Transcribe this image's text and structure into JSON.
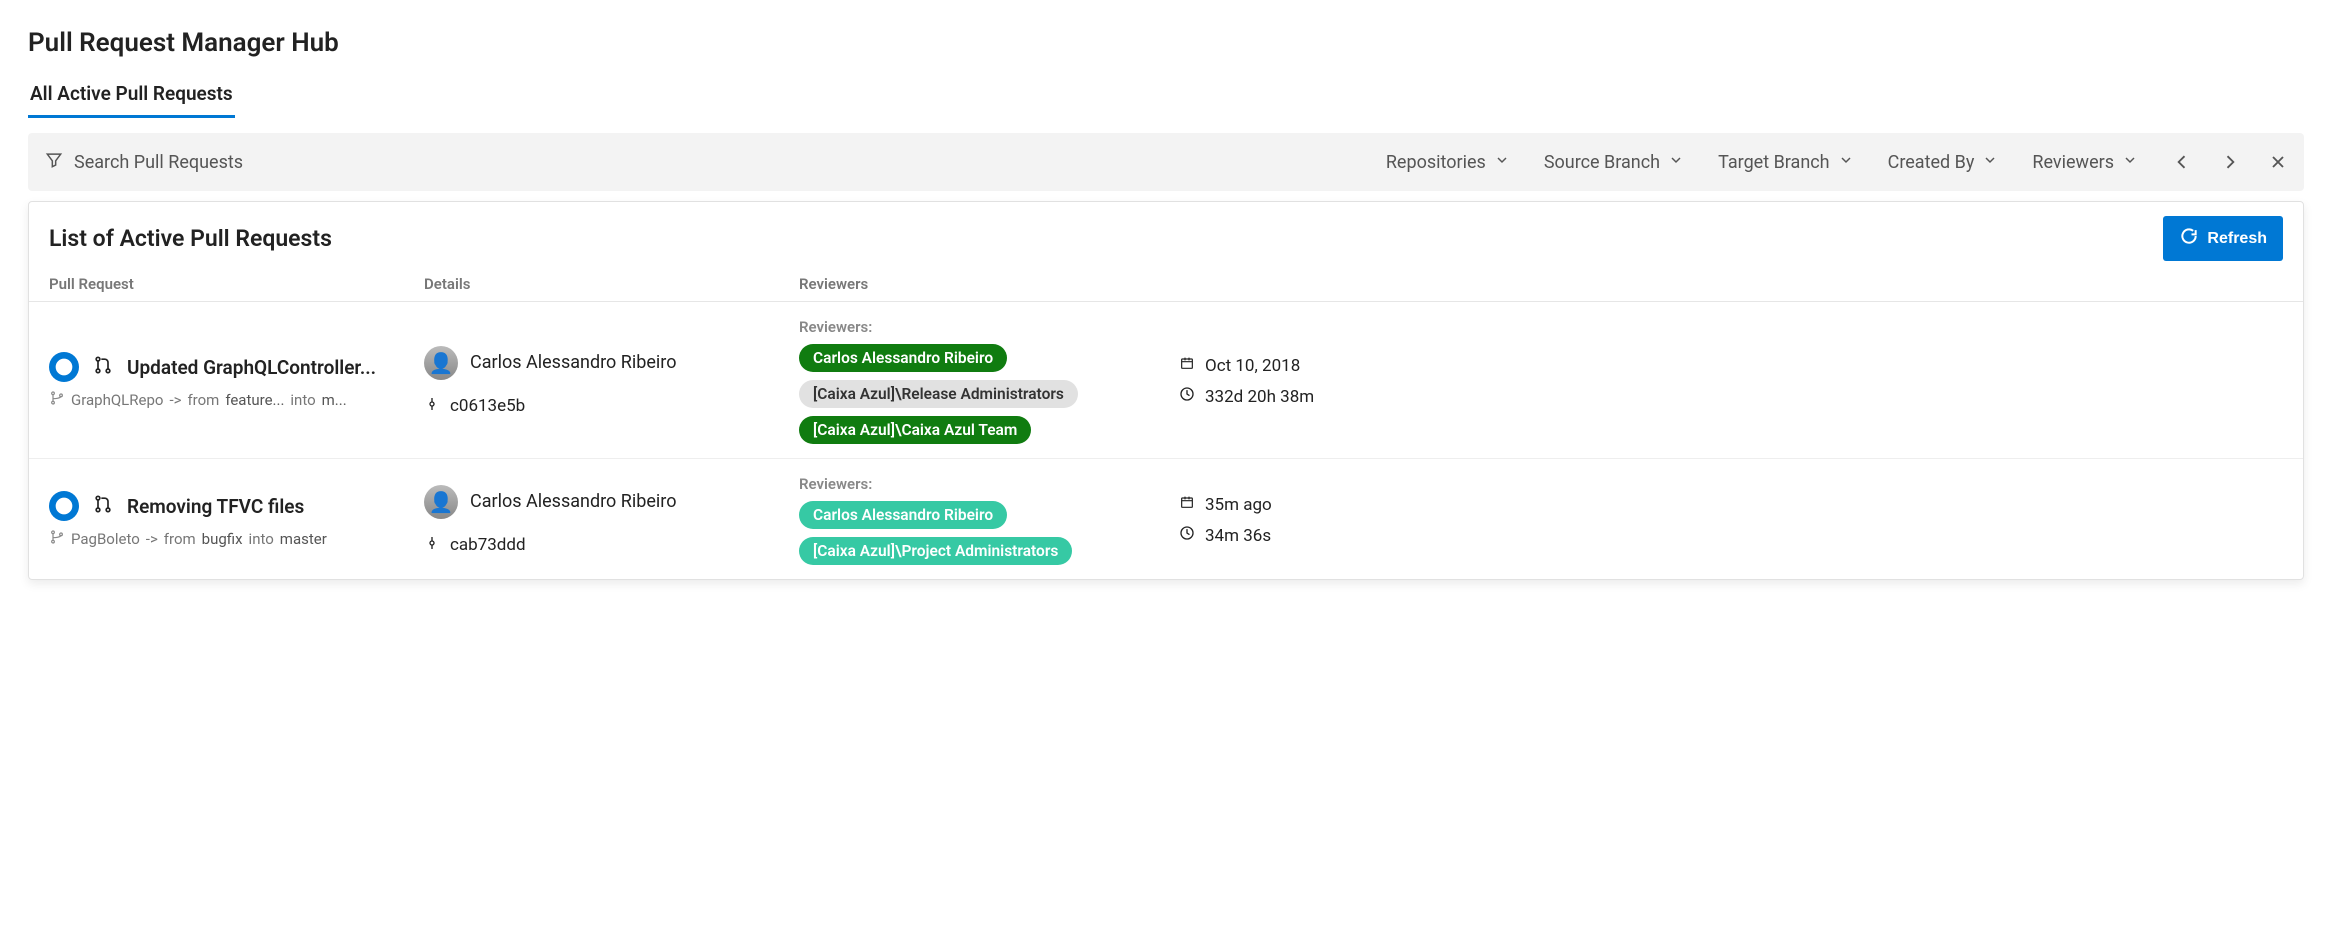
{
  "header": {
    "title": "Pull Request Manager Hub"
  },
  "tabs": {
    "active": "All Active Pull Requests"
  },
  "filter": {
    "search_placeholder": "Search Pull Requests",
    "dropdowns": {
      "repositories": "Repositories",
      "source_branch": "Source Branch",
      "target_branch": "Target Branch",
      "created_by": "Created By",
      "reviewers": "Reviewers"
    }
  },
  "card": {
    "title": "List of Active Pull Requests",
    "refresh_label": "Refresh",
    "columns": {
      "pr": "Pull Request",
      "details": "Details",
      "reviewers": "Reviewers"
    }
  },
  "labels": {
    "reviewers_heading": "Reviewers:",
    "from_word": "from",
    "into_word": "into",
    "arrow_sep": "->"
  },
  "rows": [
    {
      "title": "Updated GraphQLController...",
      "repo": "GraphQLRepo",
      "source_branch": "feature...",
      "target_branch": "m...",
      "author": "Carlos Alessandro Ribeiro",
      "commit": "c0613e5b",
      "reviewers": [
        {
          "name": "Carlos Alessandro Ribeiro",
          "style": "dark-green"
        },
        {
          "name": "[Caixa Azul]\\Release Administrators",
          "style": "grey"
        },
        {
          "name": "[Caixa Azul]\\Caixa Azul Team",
          "style": "dark-green"
        }
      ],
      "date": "Oct 10, 2018",
      "age": "332d 20h 38m"
    },
    {
      "title": "Removing TFVC files",
      "repo": "PagBoleto",
      "source_branch": "bugfix",
      "target_branch": "master",
      "author": "Carlos Alessandro Ribeiro",
      "commit": "cab73ddd",
      "reviewers": [
        {
          "name": "Carlos Alessandro Ribeiro",
          "style": "teal"
        },
        {
          "name": "[Caixa Azul]\\Project Administrators",
          "style": "teal"
        }
      ],
      "date": "35m ago",
      "age": "34m 36s"
    }
  ]
}
